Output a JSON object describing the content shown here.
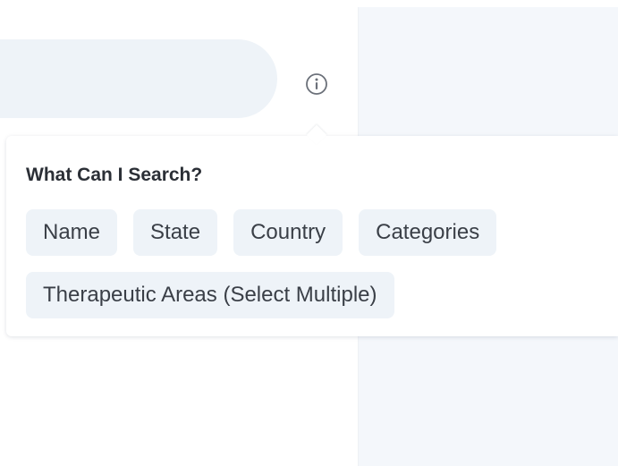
{
  "search": {
    "info_icon": "info-circle-icon"
  },
  "help_popover": {
    "title": "What Can I Search?",
    "chips": [
      {
        "label": "Name"
      },
      {
        "label": "State"
      },
      {
        "label": "Country"
      },
      {
        "label": "Categories"
      },
      {
        "label": "Therapeutic Areas (Select Multiple)"
      }
    ]
  },
  "colors": {
    "chip_background": "#eef3f8",
    "panel_background": "#f4f7fb",
    "title_text": "#2b2f36",
    "chip_text": "#3a3f47",
    "icon": "#6b7079"
  }
}
